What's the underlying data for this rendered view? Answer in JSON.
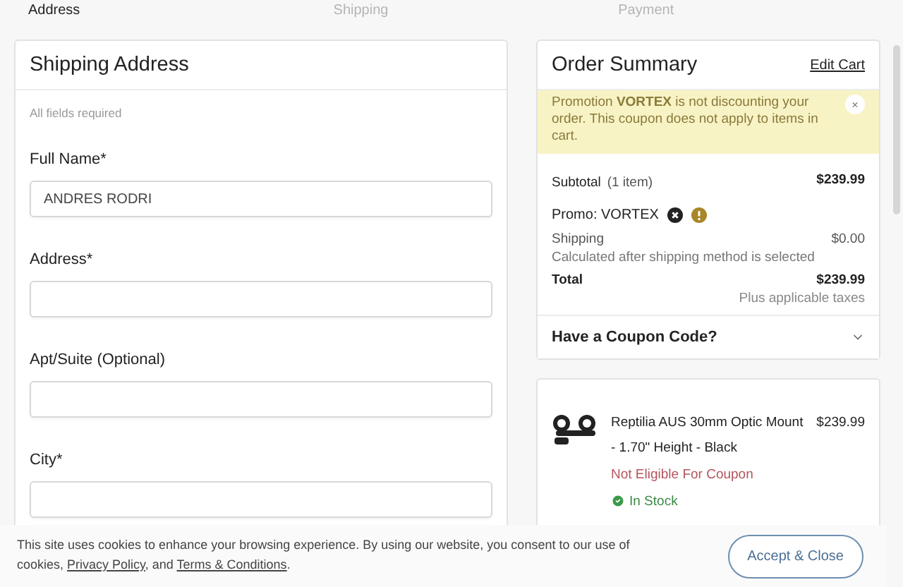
{
  "steps": [
    {
      "label": "Address",
      "selected": true
    },
    {
      "label": "Shipping",
      "selected": false
    },
    {
      "label": "Payment",
      "selected": false
    }
  ],
  "shipping_address": {
    "title": "Shipping Address",
    "note": "All fields required",
    "fields": [
      {
        "label": "Full Name*",
        "value": "ANDRES RODRI"
      },
      {
        "label": "Address*"
      },
      {
        "label": "Apt/Suite (Optional)"
      },
      {
        "label": "City*"
      }
    ]
  },
  "order_summary": {
    "title": "Order Summary",
    "edit_link": "Edit Cart",
    "alert": {
      "message": "Promotion **VORTEX** is not discounting your order. This coupon does not apply to items in cart.",
      "dismiss": "×"
    },
    "subtotal": {
      "label": "Subtotal",
      "count": "(1 item)",
      "amount": "$239.99"
    },
    "promo": {
      "label": "Promo: VORTEX"
    },
    "shipping": {
      "label": "Shipping",
      "amount": "$0.00",
      "note": "Calculated after shipping method is selected"
    },
    "total": {
      "label": "Total",
      "amount": "$239.99",
      "note": "Plus applicable taxes"
    },
    "coupon": {
      "label": "Have a Coupon Code?",
      "expanded": false
    }
  },
  "cart_items": [
    {
      "name": "Reptilia AUS 30mm Optic Mount - 1.70\" Height - Black",
      "price": "$239.99",
      "eligibility": "Not Eligible For Coupon",
      "stock": "In Stock"
    }
  ],
  "cookie_banner": {
    "parts": [
      {
        "kind": "text",
        "text": "This site uses cookies to enhance your browsing experience. By using our website, you consent to our use of cookies,"
      },
      {
        "kind": "link",
        "text": "Privacy Policy"
      },
      {
        "kind": "text",
        "text": ", and"
      },
      {
        "kind": "link",
        "text": "Terms & Conditions"
      },
      {
        "kind": "text",
        "text": "."
      }
    ],
    "button": "Accept & Close"
  }
}
